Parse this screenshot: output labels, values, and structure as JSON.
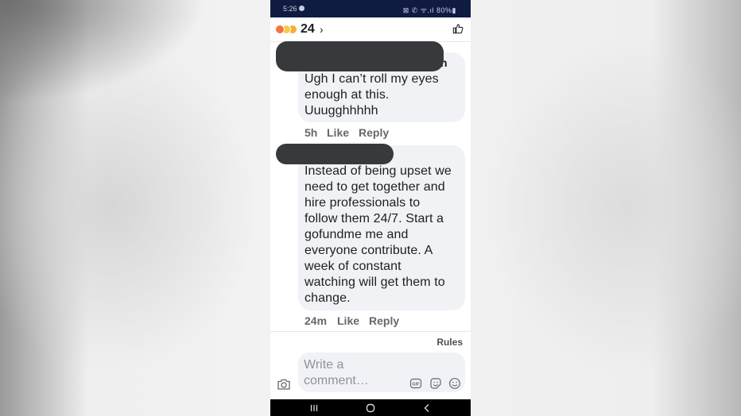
{
  "status_bar": {
    "time": "5:26",
    "right_indicators": "⊠ ✆ ᯤ.ıl 80%▮"
  },
  "header": {
    "reaction_icons": [
      "angry-icon",
      "wow-icon",
      "haha-icon"
    ],
    "reaction_count": "24",
    "chevron": "›"
  },
  "comments": [
    {
      "author_hidden": true,
      "author_fragment": "h",
      "text": "Ugh I can’t roll my eyes\nenough at this.\nUuugghhhhh",
      "time": "5h",
      "like_label": "Like",
      "reply_label": "Reply"
    },
    {
      "author_hidden": true,
      "text": "Instead of being upset we\nneed to get together and\nhire professionals to\nfollow them 24/7. Start a\ngofundme me and\neveryone contribute. A\nweek of constant\nwatching will get them to\nchange.",
      "time": "24m",
      "like_label": "Like",
      "reply_label": "Reply"
    }
  ],
  "composer": {
    "rules_label": "Rules",
    "placeholder": "Write a comment…",
    "icons": [
      "camera-icon",
      "gif-icon",
      "sticker-icon",
      "emoji-icon"
    ]
  },
  "nav_bar": {
    "icons": [
      "recent-apps-icon",
      "home-icon",
      "back-icon"
    ]
  },
  "colors": {
    "status_bar": "#0f1b40",
    "bubble": "#f0f2f5",
    "meta_text": "#65676b",
    "redaction": "#37393d"
  }
}
